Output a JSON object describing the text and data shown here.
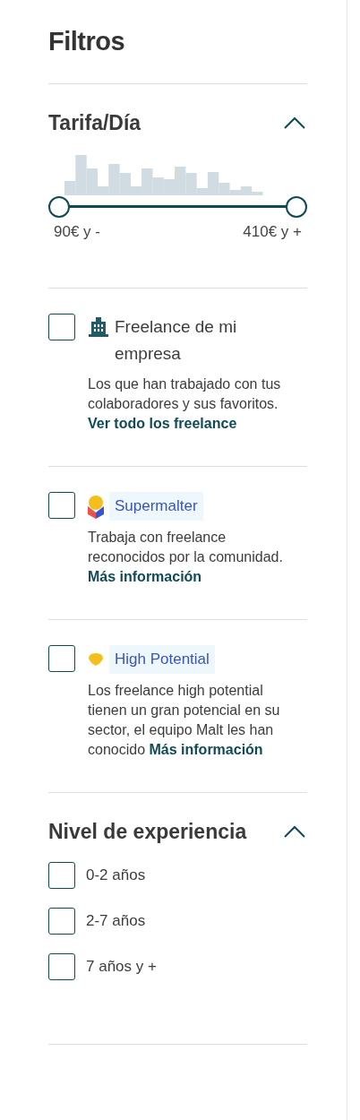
{
  "title": "Filtros",
  "rate": {
    "heading": "Tarifa/Día",
    "expanded": true,
    "min_label": "90€ y -",
    "max_label": "410€ y +"
  },
  "options": [
    {
      "kind": "company",
      "label": "Freelance de mi empresa",
      "checked": false,
      "description": "Los que han trabajado con tus colaboradores y sus favoritos.",
      "link": "Ver todo los freelance"
    },
    {
      "kind": "supermalter",
      "label": "Supermalter",
      "checked": false,
      "description": "Trabaja con freelance reconocidos por la comunidad.",
      "link": "Más información"
    },
    {
      "kind": "potential",
      "label": "High Potential",
      "checked": false,
      "description": "Los freelance high potential tienen un gran potencial en su sector, el equipo Malt les han conocido",
      "link": "Más información"
    }
  ],
  "experience": {
    "heading": "Nivel de experiencia",
    "expanded": true,
    "items": [
      {
        "label": "0-2 años",
        "checked": false
      },
      {
        "label": "2-7 años",
        "checked": false
      },
      {
        "label": "7 años y +",
        "checked": false
      }
    ]
  }
}
